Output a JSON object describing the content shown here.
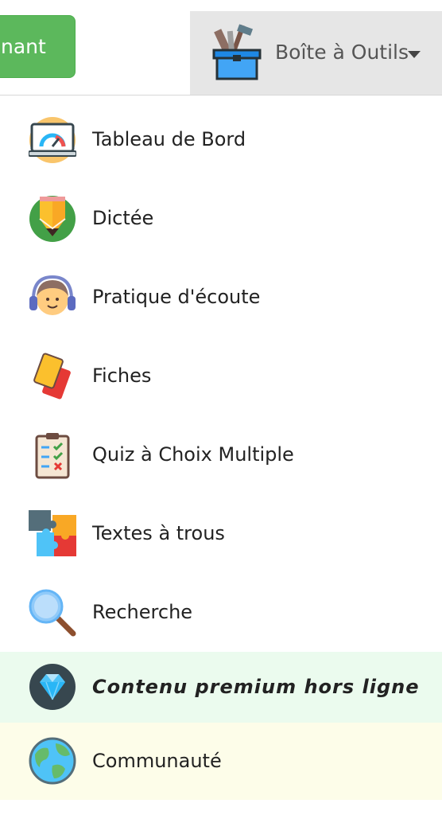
{
  "header": {
    "cta_label": "nant",
    "toolbox_label": "Boîte à Outils",
    "colors": {
      "cta": "#5cb85c",
      "toolbox_bg": "#e6e6e6"
    }
  },
  "menu": {
    "items": [
      {
        "label": "Tableau de Bord",
        "icon": "dashboard-gauge-icon"
      },
      {
        "label": "Dictée",
        "icon": "pencil-icon"
      },
      {
        "label": "Pratique d'écoute",
        "icon": "headphones-listener-icon"
      },
      {
        "label": "Fiches",
        "icon": "flashcards-icon"
      },
      {
        "label": "Quiz à Choix Multiple",
        "icon": "quiz-clipboard-icon"
      },
      {
        "label": "Textes à trous",
        "icon": "puzzle-icon"
      },
      {
        "label": "Recherche",
        "icon": "magnifier-icon"
      },
      {
        "label": "Contenu premium hors ligne",
        "icon": "diamond-icon"
      },
      {
        "label": "Communauté",
        "icon": "globe-icon"
      }
    ],
    "colors": {
      "premium_bg": "#ebfbee",
      "community_bg": "#fdfde9"
    }
  }
}
